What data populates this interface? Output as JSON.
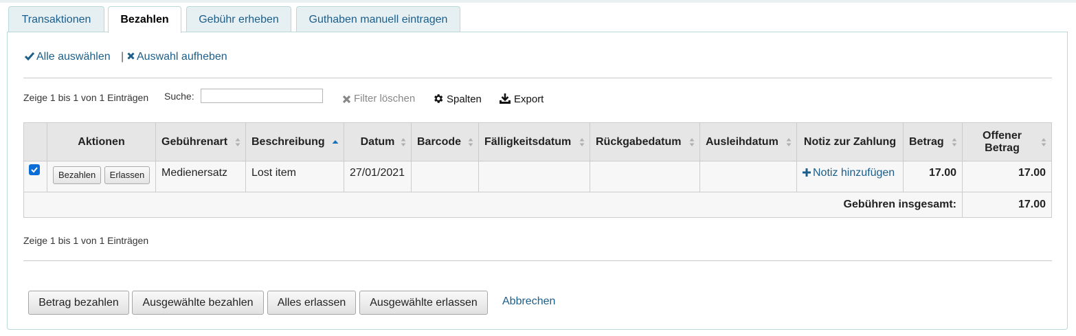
{
  "tabs": [
    {
      "label": "Transaktionen",
      "active": false
    },
    {
      "label": "Bezahlen",
      "active": true
    },
    {
      "label": "Gebühr erheben",
      "active": false
    },
    {
      "label": "Guthaben manuell eintragen",
      "active": false
    }
  ],
  "selection": {
    "select_all": "Alle auswählen",
    "separator": "|",
    "clear_selection": "Auswahl aufheben"
  },
  "table_tools": {
    "info_top": "Zeige 1 bis 1 von 1 Einträgen",
    "search_label": "Suche:",
    "search_value": "",
    "clear_filter": "Filter löschen",
    "columns": "Spalten",
    "export": "Export"
  },
  "table": {
    "headers": [
      "",
      "Aktionen",
      "Gebührenart",
      "Beschreibung",
      "Datum",
      "Barcode",
      "Fälligkeitsdatum",
      "Rückgabedatum",
      "Ausleihdatum",
      "Notiz zur Zahlung",
      "Betrag",
      "Offener Betrag"
    ],
    "rows": [
      {
        "checked": true,
        "pay_button": "Bezahlen",
        "writeoff_button": "Erlassen",
        "fee_type": "Medienersatz",
        "description": "Lost item",
        "date": "27/01/2021",
        "barcode": "",
        "due_date": "",
        "return_date": "",
        "checkout_date": "",
        "note_link": "Notiz hinzufügen",
        "amount": "17.00",
        "outstanding": "17.00"
      }
    ],
    "footer": {
      "label": "Gebühren insgesamt:",
      "total": "17.00"
    }
  },
  "info_bottom": "Zeige 1 bis 1 von 1 Einträgen",
  "actions": {
    "pay_amount": "Betrag bezahlen",
    "pay_selected": "Ausgewählte bezahlen",
    "writeoff_all": "Alles erlassen",
    "writeoff_selected": "Ausgewählte erlassen",
    "cancel": "Abbrechen"
  },
  "colors": {
    "link": "#1b5e8a",
    "amount": "#c00000",
    "tab_border": "#b9d8d9",
    "checkbox": "#0b6ed6"
  }
}
